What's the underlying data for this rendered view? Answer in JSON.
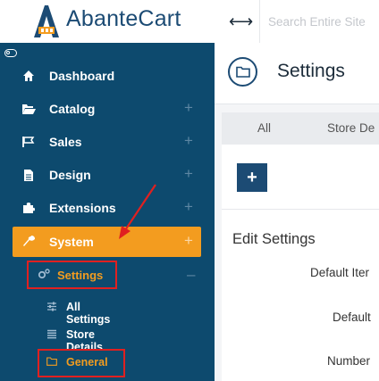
{
  "app": {
    "logo_text": "AbanteCart"
  },
  "header": {
    "search_placeholder": "Search Entire Site"
  },
  "sidebar": {
    "items": [
      {
        "label": "Dashboard",
        "icon": "home-icon",
        "expandable": false
      },
      {
        "label": "Catalog",
        "icon": "folder-open-icon",
        "expandable": true
      },
      {
        "label": "Sales",
        "icon": "flag-icon",
        "expandable": true
      },
      {
        "label": "Design",
        "icon": "file-icon",
        "expandable": true
      },
      {
        "label": "Extensions",
        "icon": "puzzle-icon",
        "expandable": true
      },
      {
        "label": "System",
        "icon": "wrench-icon",
        "expandable": true,
        "active": true
      }
    ],
    "expand_symbol": "+",
    "collapse_symbol": "–",
    "submenu": {
      "label": "Settings",
      "icon": "cogs-icon",
      "items": [
        {
          "label": "All Settings",
          "icon": "sliders-icon"
        },
        {
          "label": "Store Details",
          "icon": "list-icon"
        },
        {
          "label": "General",
          "icon": "folder-icon",
          "active": true
        }
      ]
    }
  },
  "main": {
    "title": "Settings",
    "tabs": [
      {
        "label": "All"
      },
      {
        "label": "Store De"
      }
    ],
    "add_button_label": "+",
    "section_heading": "Edit Settings",
    "field_labels": [
      "Default Iter",
      "Default",
      "Number"
    ]
  },
  "colors": {
    "sidebar_bg": "#0d4a6e",
    "accent_orange": "#f39c1f",
    "brand_blue": "#1c4b74",
    "highlight_red": "#e02020"
  }
}
